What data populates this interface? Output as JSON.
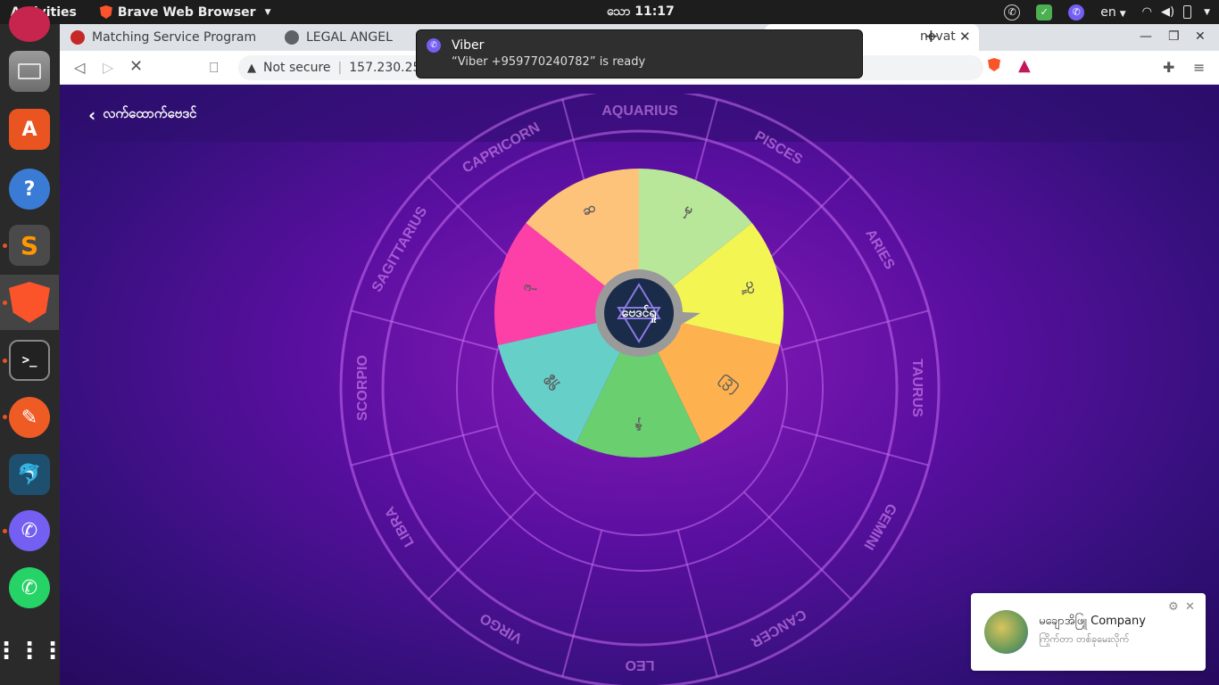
{
  "topbar": {
    "activities": "Activities",
    "app_name": "Brave Web Browser",
    "clock": "သော 11:17",
    "language": "en"
  },
  "browser": {
    "tabs": [
      {
        "label": "Matching Service Program"
      },
      {
        "label": "LEGAL ANGEL"
      },
      {
        "label": "novat"
      }
    ],
    "security_label": "Not secure",
    "url": "157.230.254."
  },
  "notification": {
    "title": "Viber",
    "body": "“Viber +959770240782” is ready"
  },
  "page": {
    "back_label": "လက်ထောက်ဗေဒင်",
    "wheel": {
      "center_label": "ဗေဒင်ရှု",
      "segments": [
        {
          "label": "မှ",
          "color": "#b9e79a"
        },
        {
          "label": "သူ",
          "color": "#f3f553"
        },
        {
          "label": "ကြ",
          "color": "#fdb24f"
        },
        {
          "label": "နှ",
          "color": "#69cf6f"
        },
        {
          "label": "ရှစ္စ",
          "color": "#65cfc8"
        },
        {
          "label": "ဒု",
          "color": "#fd3fa8"
        },
        {
          "label": "ဆ",
          "color": "#fec37a"
        }
      ]
    },
    "zodiac_labels": [
      "PISCES",
      "ARIES",
      "TAURUS",
      "GEMINI",
      "CANCER",
      "LEO",
      "VIRGO",
      "LIBRA",
      "SCORPIO",
      "SAGITTARIUS",
      "CAPRICORN",
      "AQUARIUS"
    ]
  },
  "fb_chat": {
    "name": "မချောအိဖြူ Company",
    "subtitle": "ကြိုက်တာ တစ်ခုမေးလိုက်"
  }
}
